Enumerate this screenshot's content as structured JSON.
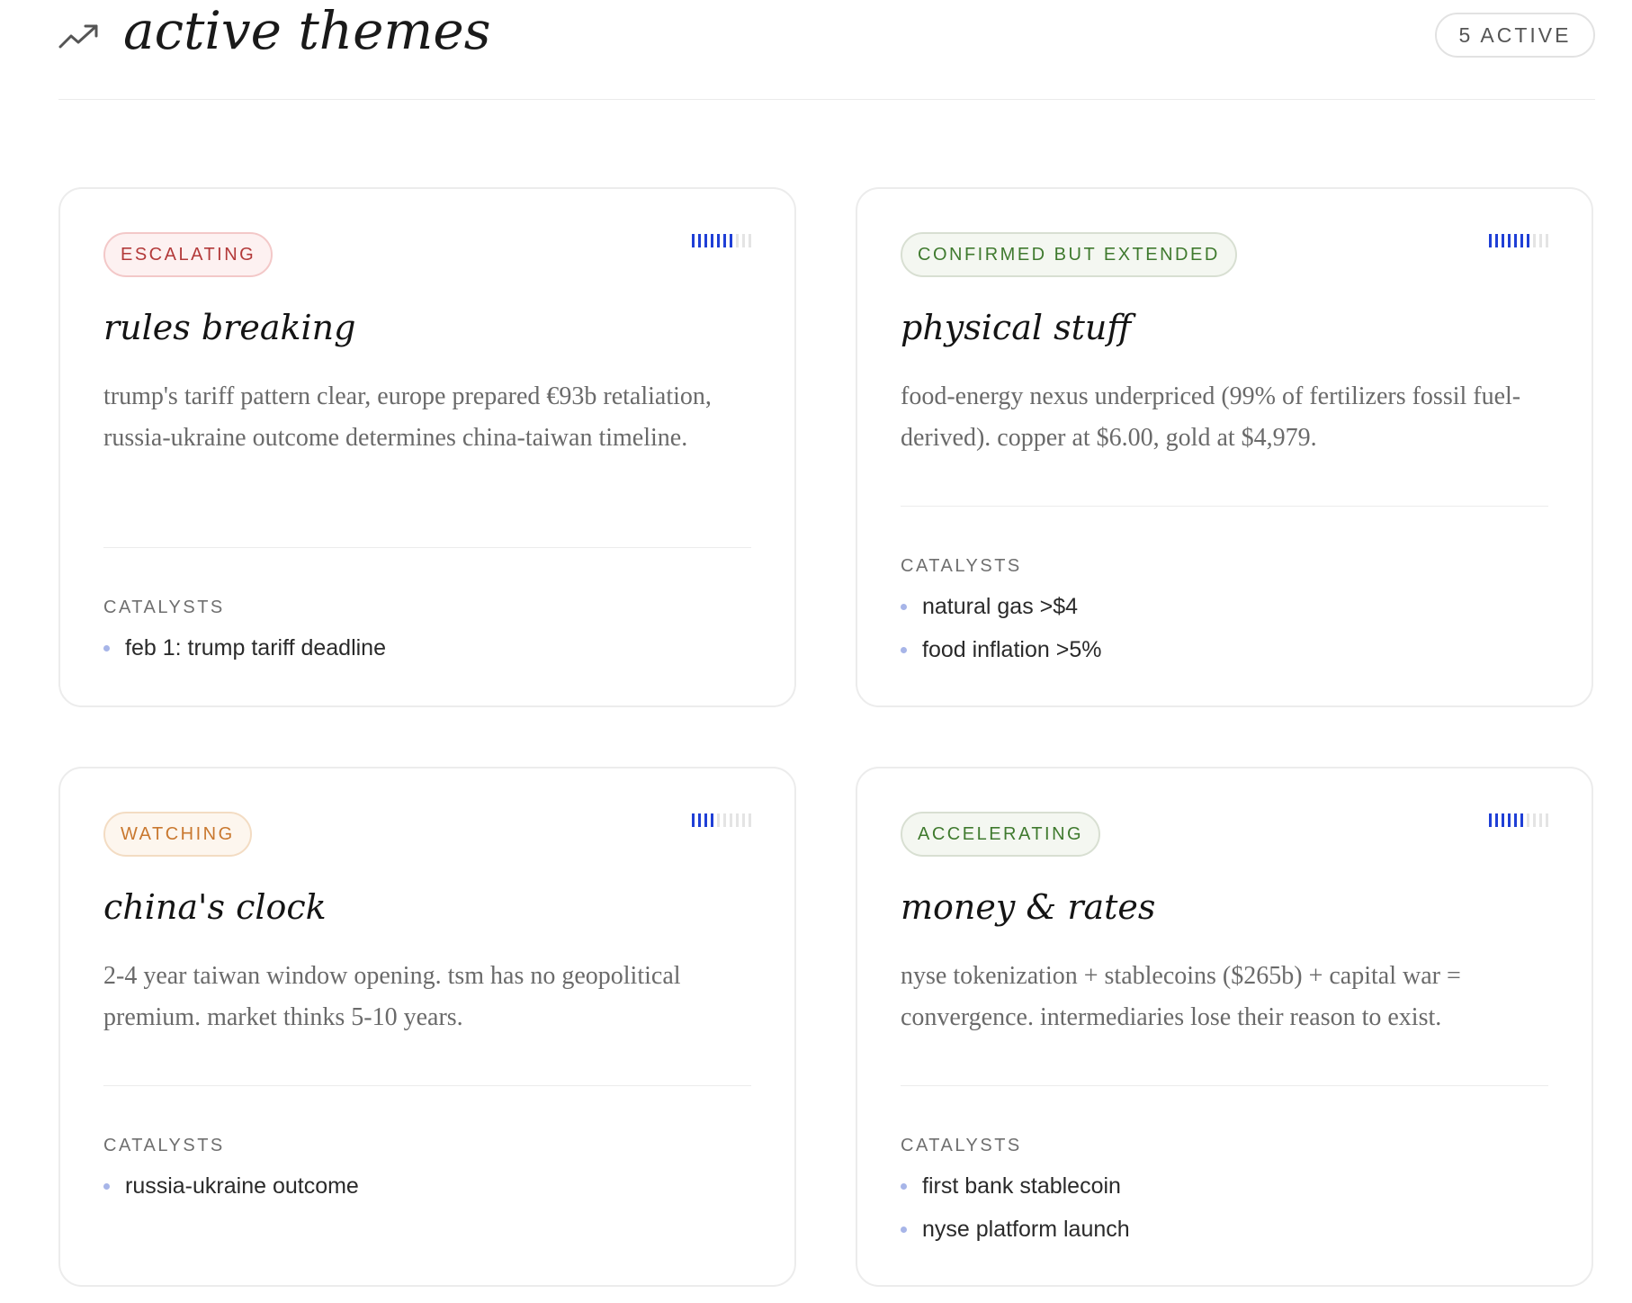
{
  "header": {
    "title": "active themes",
    "count_badge": "5 ACTIVE",
    "icon": "trending-up-icon"
  },
  "cards": [
    {
      "status": "ESCALATING",
      "status_color": "#b33a3a",
      "meter_level": 7,
      "meter_max": 10,
      "title": "rules breaking",
      "description": "trump's tariff pattern clear, europe prepared €93b retaliation, russia-ukraine outcome determines china-taiwan timeline.",
      "catalysts_label": "CATALYSTS",
      "catalysts": [
        "feb 1: trump tariff deadline"
      ]
    },
    {
      "status": "CONFIRMED BUT EXTENDED",
      "status_color": "#3f7a2e",
      "meter_level": 7,
      "meter_max": 10,
      "title": "physical stuff",
      "description": "food-energy nexus underpriced (99% of fertilizers fossil fuel-derived). copper at $6.00, gold at $4,979.",
      "catalysts_label": "CATALYSTS",
      "catalysts": [
        "natural gas >$4",
        "food inflation >5%"
      ]
    },
    {
      "status": "WATCHING",
      "status_color": "#c9782f",
      "meter_level": 4,
      "meter_max": 10,
      "title": "china's clock",
      "description": "2-4 year taiwan window opening. tsm has no geopolitical premium. market thinks 5-10 years.",
      "catalysts_label": "CATALYSTS",
      "catalysts": [
        "russia-ukraine outcome"
      ]
    },
    {
      "status": "ACCELERATING",
      "status_color": "#3f7a2e",
      "meter_level": 6,
      "meter_max": 10,
      "title": "money & rates",
      "description": "nyse tokenization + stablecoins ($265b) + capital war = convergence. intermediaries lose their reason to exist.",
      "catalysts_label": "CATALYSTS",
      "catalysts": [
        "first bank stablecoin",
        "nyse platform launch"
      ]
    }
  ],
  "meter_colors": {
    "on": "#1f3fd6",
    "off": "#e4e4e4"
  }
}
